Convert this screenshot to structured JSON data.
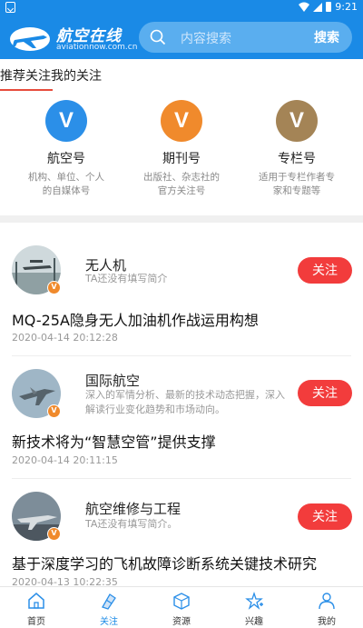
{
  "status": {
    "time": "9:21"
  },
  "header": {
    "logo_name": "航空在线",
    "logo_url": "aviationnow.com.cn",
    "search_placeholder": "内容搜索",
    "search_button": "搜索"
  },
  "page_title": "推荐关注我的关注",
  "categories": [
    {
      "icon": "V",
      "name": "航空号",
      "desc1": "机构、单位、个人",
      "desc2": "的自媒体号",
      "color": "#2b8fe8"
    },
    {
      "icon": "V",
      "name": "期刊号",
      "desc1": "出版社、杂志社的",
      "desc2": "官方关注号",
      "color": "#f08a2c"
    },
    {
      "icon": "V",
      "name": "专栏号",
      "desc1": "适用于专栏作者专",
      "desc2": "家和专题等",
      "color": "#a48456"
    }
  ],
  "feed": [
    {
      "author": "无人机",
      "bio": "TA还没有填写简介",
      "follow_label": "关注",
      "title": "MQ-25A隐身无人加油机作战运用构想",
      "time": "2020-04-14 20:12:28"
    },
    {
      "author": "国际航空",
      "bio": "深入的军情分析、最新的技术动态把握，深入解读行业变化趋势和市场动向。",
      "follow_label": "关注",
      "title": "新技术将为“智慧空管”提供支撑",
      "time": "2020-04-14 20:11:15"
    },
    {
      "author": "航空维修与工程",
      "bio": "TA还没有填写简介。",
      "follow_label": "关注",
      "title": "基于深度学习的飞机故障诊断系统关键技术研究",
      "time": "2020-04-13 10:22:35"
    }
  ],
  "nav": [
    {
      "label": "首页",
      "icon": "home-icon"
    },
    {
      "label": "关注",
      "icon": "follow-icon"
    },
    {
      "label": "资源",
      "icon": "box-icon"
    },
    {
      "label": "兴趣",
      "icon": "star-plus-icon"
    },
    {
      "label": "我的",
      "icon": "user-icon"
    }
  ],
  "colors": {
    "brand": "#1a8ae6",
    "follow": "#f23c3c",
    "accent_underline": "#e74c3c"
  }
}
